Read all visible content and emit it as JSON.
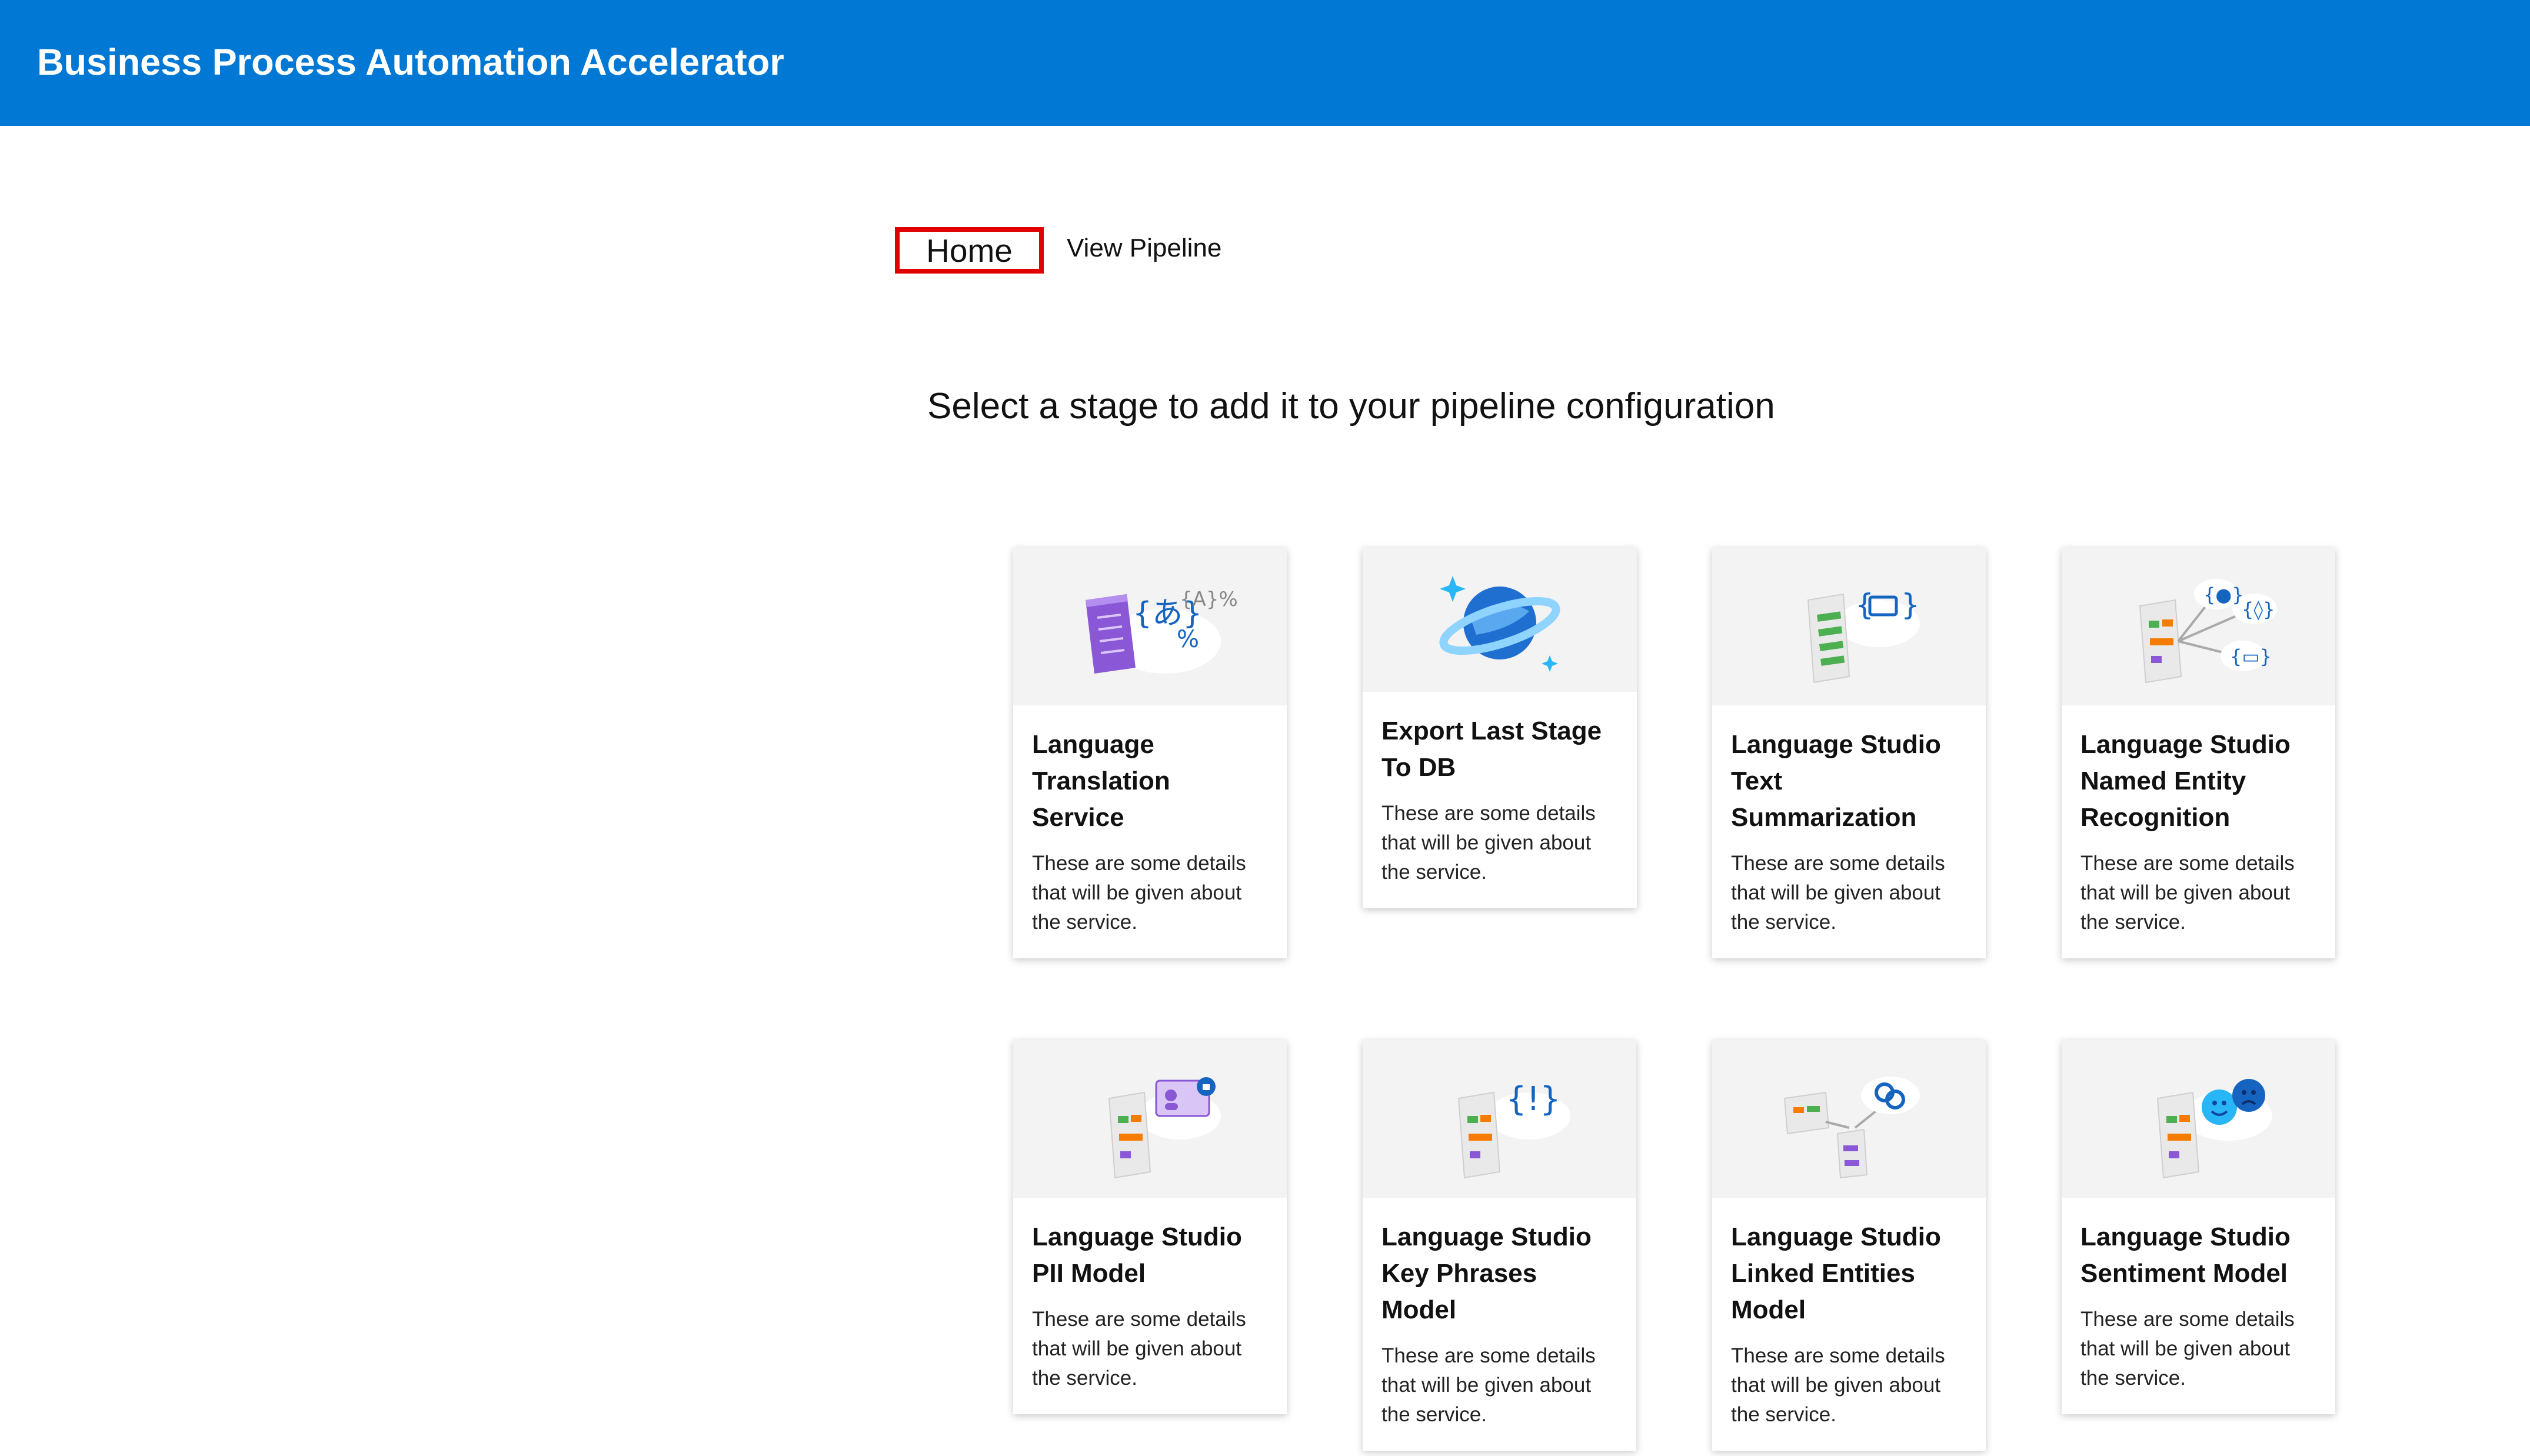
{
  "header": {
    "title": "Business Process Automation Accelerator",
    "color": "#0078d4"
  },
  "nav": {
    "home_label": "Home",
    "pipeline_label": "View Pipeline"
  },
  "main": {
    "subtitle": "Select a stage to add it to your pipeline configuration"
  },
  "cards": [
    {
      "title": "Language Translation Service",
      "desc": "These are some details that will be given about the service.",
      "icon": "translation-icon"
    },
    {
      "title": "Export Last Stage To DB",
      "desc": "These are some details that will be given about the service.",
      "icon": "database-planet-icon"
    },
    {
      "title": "Language Studio Text Summarization",
      "desc": "These are some details that will be given about the service.",
      "icon": "summarization-icon"
    },
    {
      "title": "Language Studio Named Entity Recognition",
      "desc": "These are some details that will be given about the service.",
      "icon": "entity-recognition-icon"
    },
    {
      "title": "Language Studio PII Model",
      "desc": "These are some details that will be given about the service.",
      "icon": "pii-icon"
    },
    {
      "title": "Language Studio Key Phrases Model",
      "desc": "These are some details that will be given about the service.",
      "icon": "key-phrases-icon"
    },
    {
      "title": "Language Studio Linked Entities Model",
      "desc": "These are some details that will be given about the service.",
      "icon": "linked-entities-icon"
    },
    {
      "title": "Language Studio Sentiment Model",
      "desc": "These are some details that will be given about the service.",
      "icon": "sentiment-icon"
    }
  ]
}
